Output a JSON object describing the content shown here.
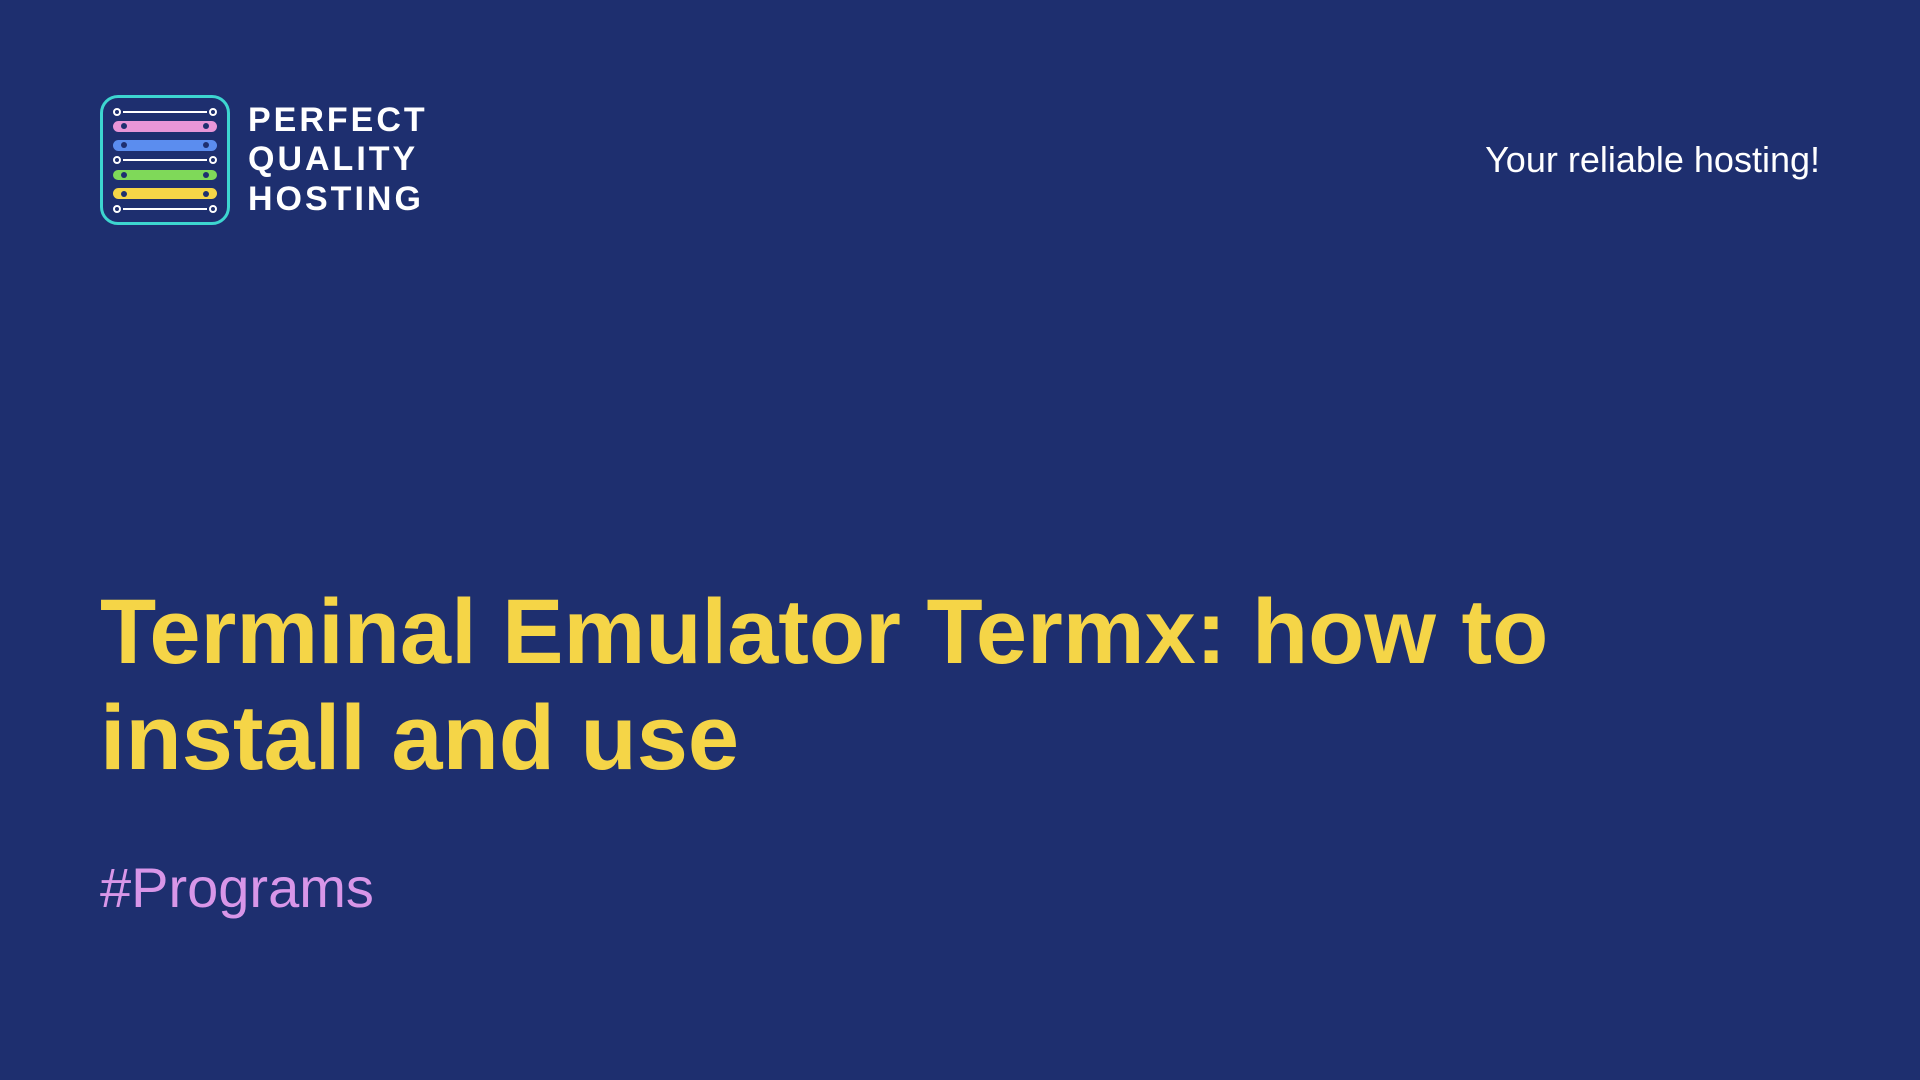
{
  "logo": {
    "line1": "PERFECT",
    "line2": "QUALITY",
    "line3": "HOSTING"
  },
  "tagline": "Your reliable hosting!",
  "title": "Terminal Emulator Termx: how to install and use",
  "hashtag": "#Programs"
}
